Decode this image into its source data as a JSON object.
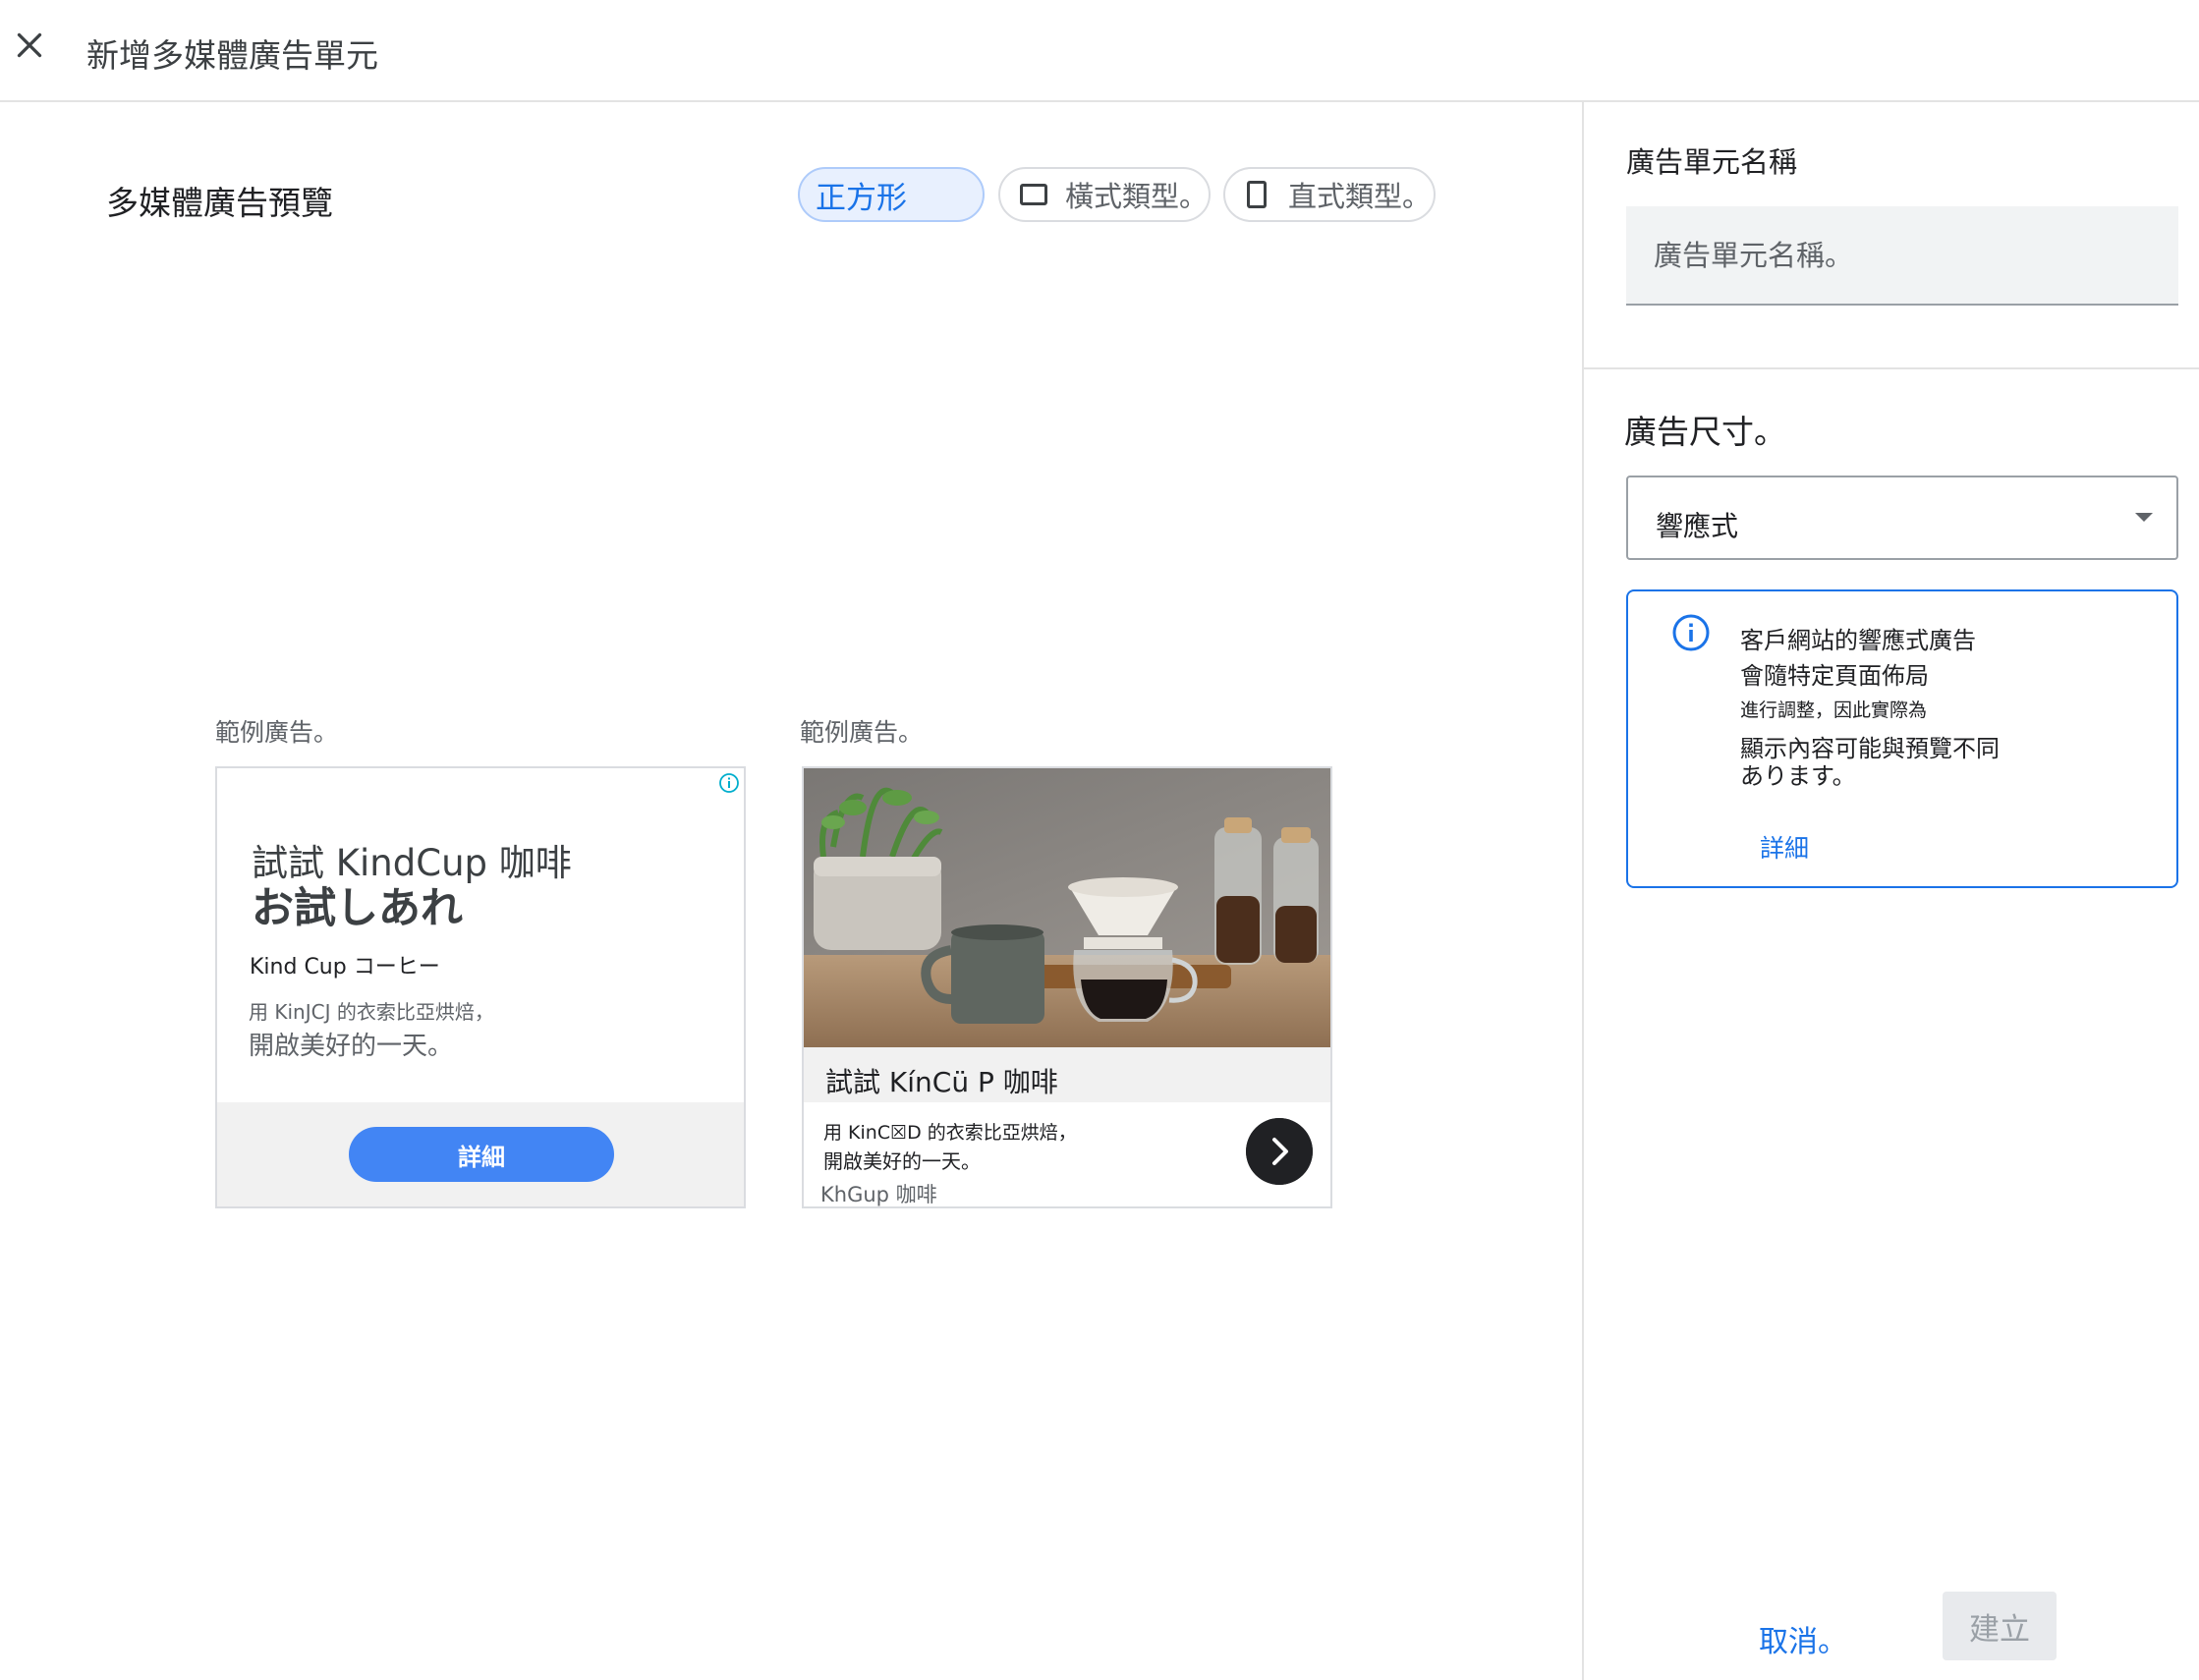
{
  "header": {
    "title": "新增多媒體廣告單元",
    "close_icon": "close-icon"
  },
  "preview": {
    "title": "多媒體廣告預覽",
    "format_chips": [
      {
        "label": "正方形",
        "selected": true
      },
      {
        "label": "橫式類型。",
        "icon": "landscape-rectangle-icon",
        "selected": false
      },
      {
        "label": "直式類型。",
        "icon": "portrait-rectangle-icon",
        "selected": false
      }
    ],
    "samples": [
      {
        "label": "範例廣告。",
        "headline_1": "試試 KindCup 咖啡",
        "headline_2": "お試しあれ",
        "brand": "Kind Cup コーヒー",
        "description_1": "用 KinJCJ 的衣索比亞烘焙，",
        "description_2": "開啟美好的一天。",
        "cta": "詳細"
      },
      {
        "label": "範例廣告。",
        "headline": "試試 KínCü P  咖啡",
        "description_1": "用 KinC☒D  的衣索比亞烘焙，",
        "description_2": "開啟美好的一天。",
        "brand": "KhGup 咖啡",
        "cta_icon": "chevron-right-icon"
      }
    ]
  },
  "settings": {
    "name_label": "廣告單元名稱",
    "name_placeholder": "廣告單元名稱。",
    "name_value": "",
    "size_label": "廣告尺寸。",
    "size_value": "響應式",
    "info_lines": [
      "客戶網站的響應式廣告",
      "會隨特定頁面佈局",
      "進行調整，因此實際為",
      "顯示內容可能與預覽不同",
      "あります。"
    ],
    "info_link": "詳細"
  },
  "footer": {
    "cancel": "取消。",
    "create": "建立"
  },
  "colors": {
    "accent": "#1a73e8",
    "chip_selected_bg": "#e8f0fe",
    "ad_cta_blue": "#4285f4"
  }
}
